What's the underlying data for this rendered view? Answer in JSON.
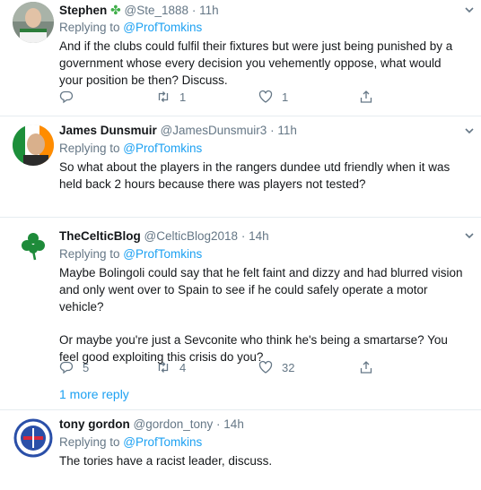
{
  "tweets": [
    {
      "name": "Stephen",
      "emoji": "✤",
      "handle": "@Ste_1888",
      "dot": "·",
      "time": "11h",
      "replying_label": "Replying to ",
      "replying_to": "@ProfTomkins",
      "text": [
        "And if the clubs could fulfil their fixtures but were just being punished by a government whose every decision you vehemently oppose, what would your position be then? Discuss."
      ],
      "reply_count": "",
      "retweet_count": "1",
      "like_count": "1"
    },
    {
      "name": "James Dunsmuir",
      "handle": "@JamesDunsmuir3",
      "dot": "·",
      "time": "11h",
      "replying_label": "Replying to ",
      "replying_to": "@ProfTomkins",
      "text": [
        "So what about the players in the rangers dundee utd friendly when it was held back 2 hours because there was players not tested?"
      ]
    },
    {
      "name": "TheCelticBlog",
      "handle": "@CelticBlog2018",
      "dot": "·",
      "time": "14h",
      "replying_label": "Replying to ",
      "replying_to": "@ProfTomkins",
      "text": [
        "Maybe Bolingoli could say that he felt faint and dizzy and had blurred vision and only went over to Spain to see if he could safely operate a motor vehicle?",
        "Or maybe you're just a Sevconite who think he's being a smartarse? You feel good exploiting this crisis do you?"
      ],
      "reply_count": "5",
      "retweet_count": "4",
      "like_count": "32",
      "more_replies": "1 more reply"
    },
    {
      "name": "tony gordon",
      "handle": "@gordon_tony",
      "dot": "·",
      "time": "14h",
      "replying_label": "Replying to ",
      "replying_to": "@ProfTomkins",
      "text": [
        "The tories have a racist leader, discuss."
      ]
    }
  ],
  "icons": {
    "reply": "reply-icon",
    "retweet": "retweet-icon",
    "like": "heart-icon",
    "share": "share-icon",
    "caret": "chevron-down-icon"
  },
  "colors": {
    "link": "#1da1f2",
    "muted": "#657786",
    "divider": "#e6ecf0",
    "text": "#14171a"
  }
}
